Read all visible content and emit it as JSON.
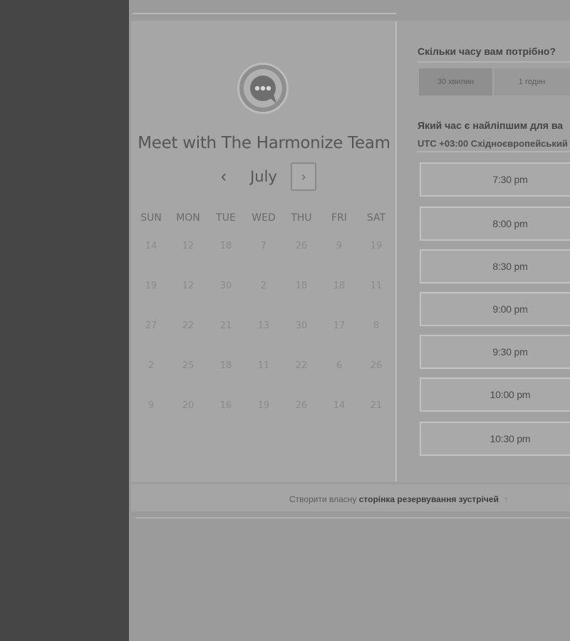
{
  "calendar": {
    "title": "Meet with The Harmonize Team",
    "month": "July",
    "prev_icon": "chevron-left-icon",
    "next_icon": "chevron-right-icon",
    "weekdays": [
      "SUN",
      "MON",
      "TUE",
      "WED",
      "THU",
      "FRI",
      "SAT"
    ],
    "weeks": [
      [
        "14",
        "12",
        "18",
        "7",
        "26",
        "9",
        "19"
      ],
      [
        "19",
        "12",
        "30",
        "2",
        "18",
        "18",
        "11"
      ],
      [
        "27",
        "22",
        "21",
        "13",
        "30",
        "17",
        "8"
      ],
      [
        "2",
        "25",
        "18",
        "11",
        "22",
        "6",
        "26"
      ],
      [
        "9",
        "20",
        "16",
        "19",
        "26",
        "14",
        "21"
      ]
    ]
  },
  "booking": {
    "duration_question": "Скільки часу вам потрібно?",
    "durations": [
      "30 хвилин",
      "1 годин"
    ],
    "time_question": "Який час є найліпшим для ва",
    "timezone": "UTC +03:00 Східноєвропейський",
    "slots": [
      "7:30 pm",
      "8:00 pm",
      "8:30 pm",
      "9:00 pm",
      "9:30 pm",
      "10:00 pm",
      "10:30 pm"
    ]
  },
  "footer": {
    "prefix": "Створити власну",
    "link": "сторінка резервування зустрічей",
    "arrow": "↑"
  }
}
